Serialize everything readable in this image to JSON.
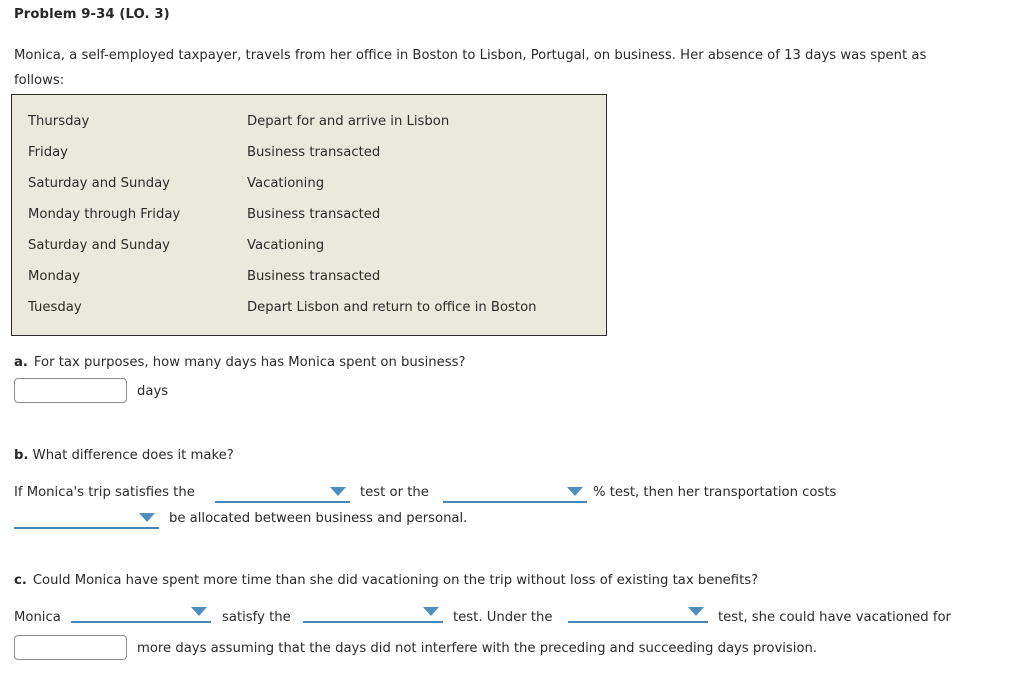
{
  "problem": {
    "title": "Problem 9-34 (LO. 3)",
    "intro": "Monica, a self-employed taxpayer, travels from her office in Boston to Lisbon, Portugal, on business. Her absence of 13 days was spent as follows:"
  },
  "schedule": {
    "rows": [
      {
        "day": "Thursday",
        "activity": "Depart for and arrive in Lisbon"
      },
      {
        "day": "Friday",
        "activity": "Business transacted"
      },
      {
        "day": "Saturday and Sunday",
        "activity": "Vacationing"
      },
      {
        "day": "Monday through Friday",
        "activity": "Business transacted"
      },
      {
        "day": "Saturday and Sunday",
        "activity": "Vacationing"
      },
      {
        "day": "Monday",
        "activity": "Business transacted"
      },
      {
        "day": "Tuesday",
        "activity": "Depart Lisbon and return to office in Boston"
      }
    ]
  },
  "part_a": {
    "label": "a.",
    "question": "For tax purposes, how many days has Monica spent on business?",
    "input_value": "",
    "input_placeholder": "",
    "unit_label": "days"
  },
  "part_b": {
    "label": "b.",
    "question": "What difference does it make?",
    "fragment_1": "If Monica's trip satisfies the",
    "fragment_2": "test or the",
    "fragment_3": "% test, then her transportation costs",
    "fragment_4": "be allocated between business and personal.",
    "dropdown_1": "",
    "dropdown_2": "",
    "dropdown_3": ""
  },
  "part_c": {
    "label": "c.",
    "question": "Could Monica have spent more time than she did vacationing on the trip without loss of existing tax benefits?",
    "fragment_1": "Monica",
    "fragment_2": "satisfy the",
    "fragment_3": "test. Under the",
    "fragment_4": "test, she could have vacationed for",
    "dropdown_1": "",
    "dropdown_2": "",
    "dropdown_3": "",
    "input_value": "",
    "input_placeholder": "",
    "trailing_text": "more days assuming that the days did not interfere with the preceding and succeeding days provision."
  },
  "colors": {
    "table_background": "#ebe9dc",
    "table_border": "#2c2c2c",
    "dropdown_accent": "#4a86b8",
    "text": "#2b2b2b",
    "input_border": "#8c8c8c"
  }
}
